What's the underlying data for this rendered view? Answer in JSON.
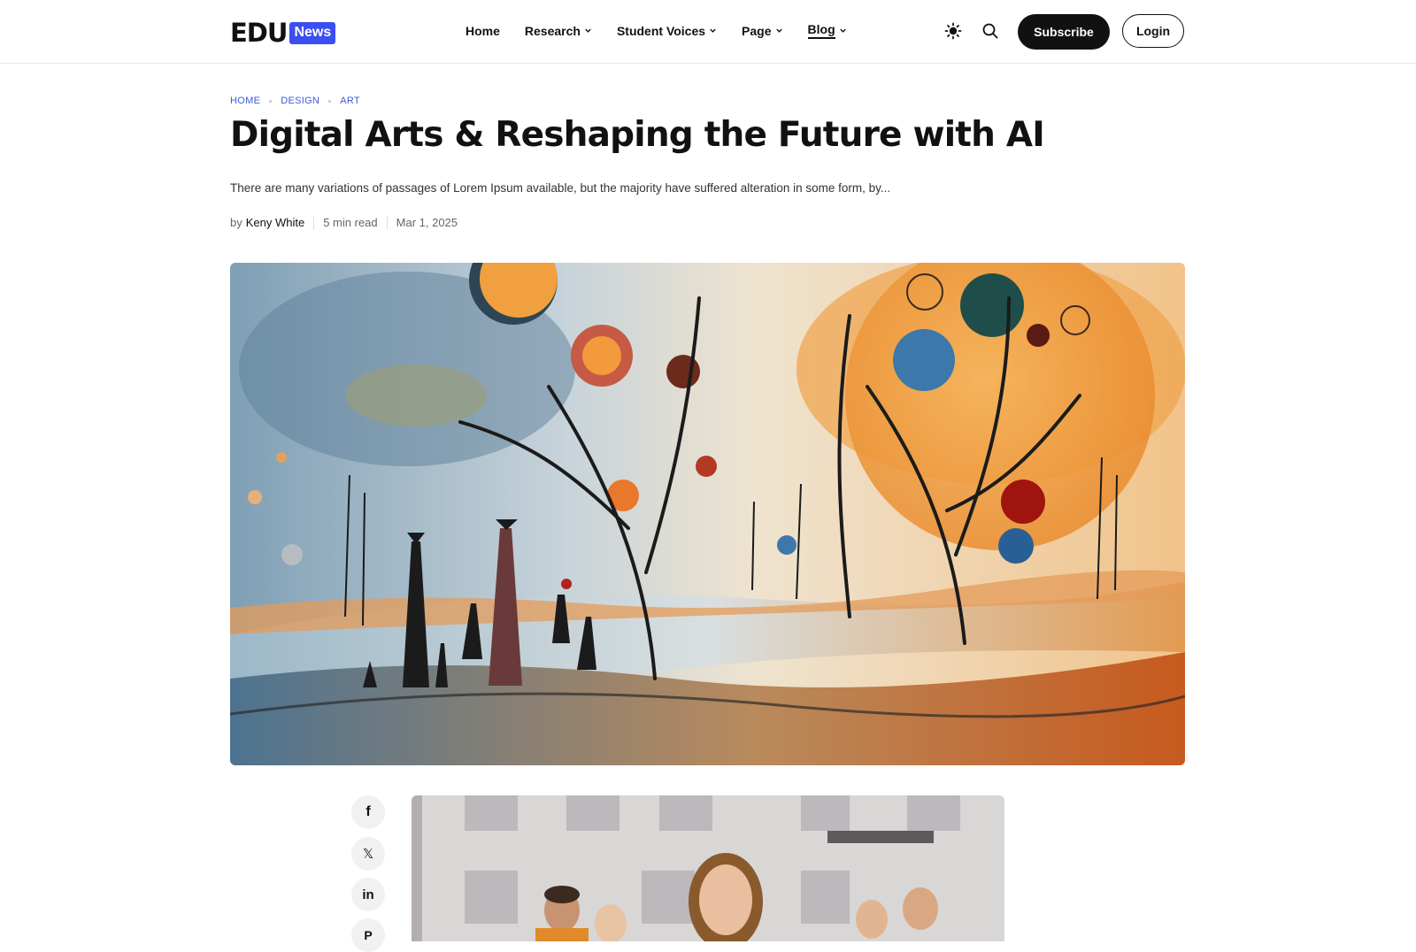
{
  "logo": {
    "main": "EDU",
    "badge": "News",
    "badge_color": "#3b4ef0"
  },
  "nav": {
    "items": [
      {
        "label": "Home",
        "has_dropdown": false
      },
      {
        "label": "Research",
        "has_dropdown": true
      },
      {
        "label": "Student Voices",
        "has_dropdown": true
      },
      {
        "label": "Page",
        "has_dropdown": true
      },
      {
        "label": "Blog",
        "has_dropdown": true,
        "active": true
      }
    ]
  },
  "header_icons": {
    "theme": "sun-icon",
    "search": "search-icon"
  },
  "buttons": {
    "subscribe": "Subscribe",
    "login": "Login"
  },
  "breadcrumb": [
    "HOME",
    "DESIGN",
    "ART"
  ],
  "article": {
    "title": "Digital Arts & Reshaping the Future with AI",
    "excerpt": "There are many variations of passages of Lorem Ipsum available, but the majority have suffered alteration in some form, by...",
    "by": "by",
    "author": "Keny White",
    "read_time": "5 min read",
    "date": "Mar 1, 2025"
  },
  "share_icons": [
    "facebook-icon",
    "x-icon",
    "linkedin-icon",
    "pinterest-icon"
  ],
  "share_glyphs": [
    "f",
    "𝕏",
    "in",
    "P"
  ],
  "colors": {
    "accent": "#3b5bd9",
    "dark": "#111111"
  }
}
